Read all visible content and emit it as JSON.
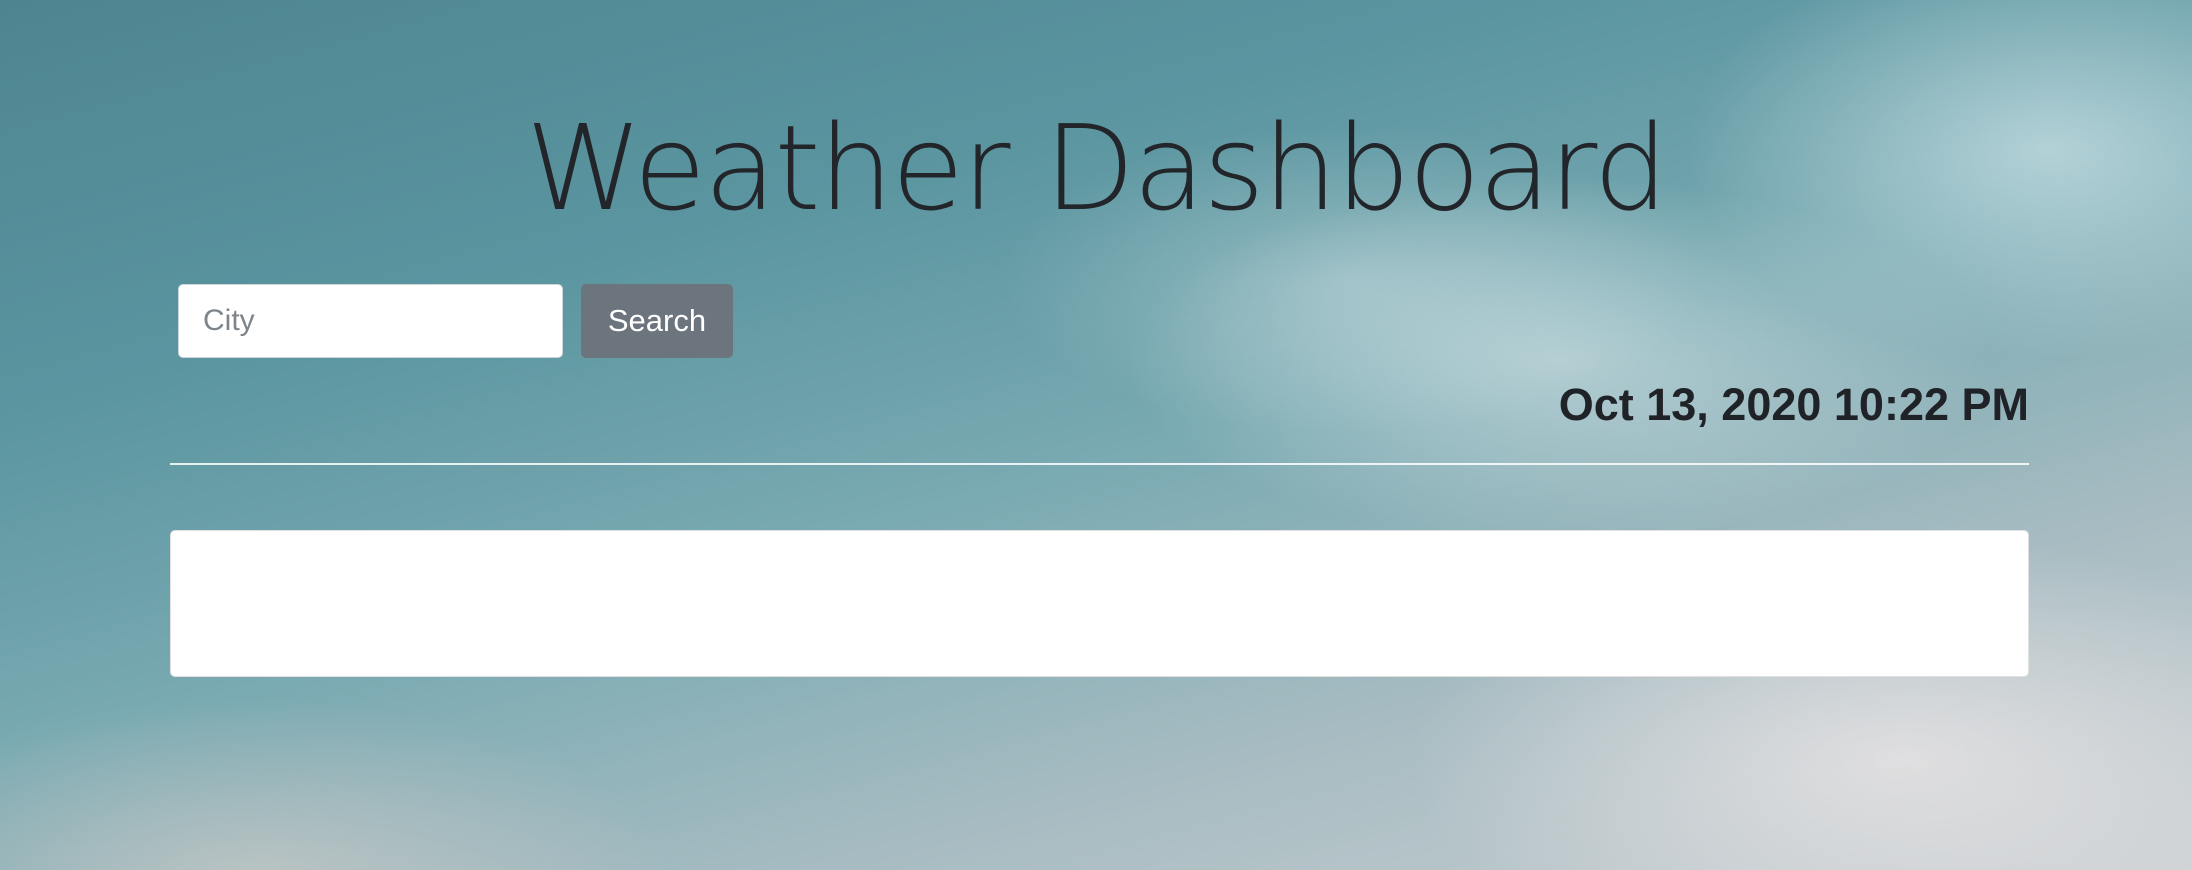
{
  "header": {
    "title": "Weather Dashboard"
  },
  "search": {
    "placeholder": "City",
    "value": "",
    "button_label": "Search"
  },
  "current": {
    "datetime": "Oct 13, 2020 10:22 PM"
  },
  "colors": {
    "button_bg": "#6c757d",
    "button_text": "#ffffff",
    "title_text": "#222529",
    "card_bg": "#ffffff"
  }
}
